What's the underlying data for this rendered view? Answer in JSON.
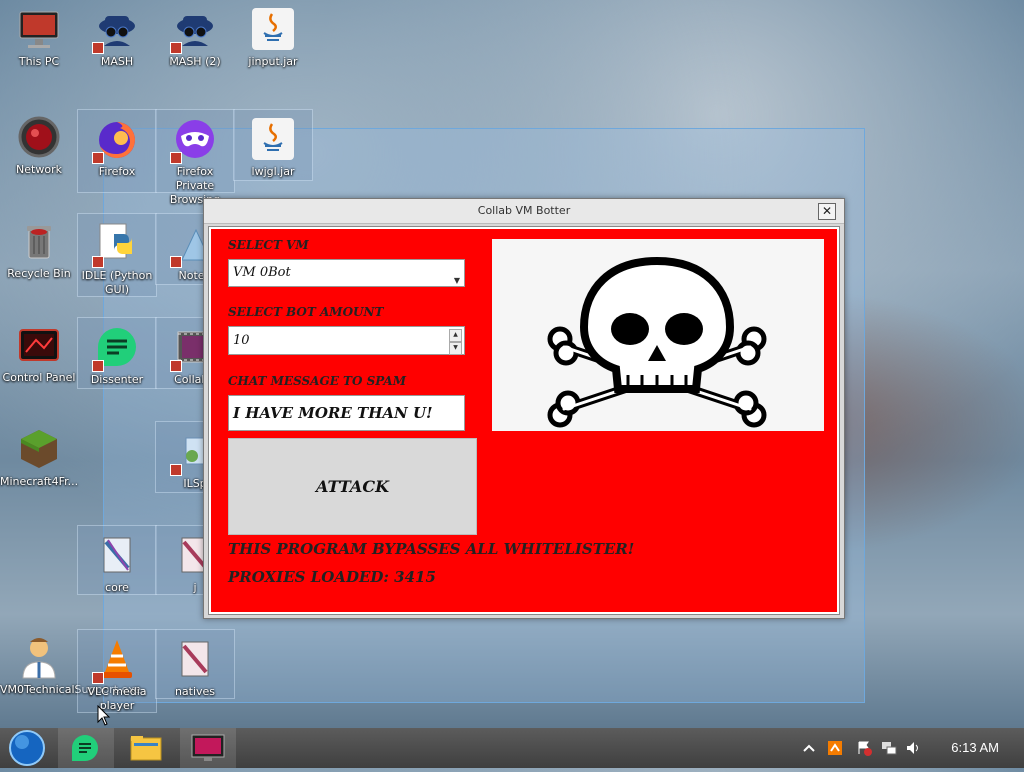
{
  "desktop": {
    "icons": [
      {
        "label": "This PC"
      },
      {
        "label": "MASH"
      },
      {
        "label": "MASH (2)"
      },
      {
        "label": "jinput.jar"
      },
      {
        "label": "Network"
      },
      {
        "label": "Firefox"
      },
      {
        "label": "Firefox Private Browsing"
      },
      {
        "label": "lwjgl.jar"
      },
      {
        "label": "Recycle Bin"
      },
      {
        "label": "IDLE (Python GUI)"
      },
      {
        "label": "Notep"
      },
      {
        "label": "Control Panel"
      },
      {
        "label": "Dissenter"
      },
      {
        "label": "CollabV"
      },
      {
        "label": "Minecraft4Fr..."
      },
      {
        "label": "ILSp"
      },
      {
        "label": "core"
      },
      {
        "label": "j"
      },
      {
        "label": "VM0TechnicalSupport.exe"
      },
      {
        "label": "VLC media player"
      },
      {
        "label": "natives"
      }
    ]
  },
  "window": {
    "title": "Collab VM Botter",
    "close_glyph": "✕",
    "select_vm_label": "SELECT VM",
    "select_vm_value": "VM 0Bot",
    "bot_amount_label": "SELECT BOT AMOUNT",
    "bot_amount_value": "10",
    "chat_label": "CHAT MESSAGE TO SPAM",
    "chat_value": "I HAVE MORE THAN U!",
    "attack_label": "ATTACK",
    "notice_1": "THIS PROGRAM BYPASSES ALL WHITELISTER!",
    "notice_2": "PROXIES LOADED: 3415"
  },
  "taskbar": {
    "clock": "6:13 AM"
  },
  "colors": {
    "client_bg": "#ff0000",
    "selection": "#6fa8dc"
  }
}
